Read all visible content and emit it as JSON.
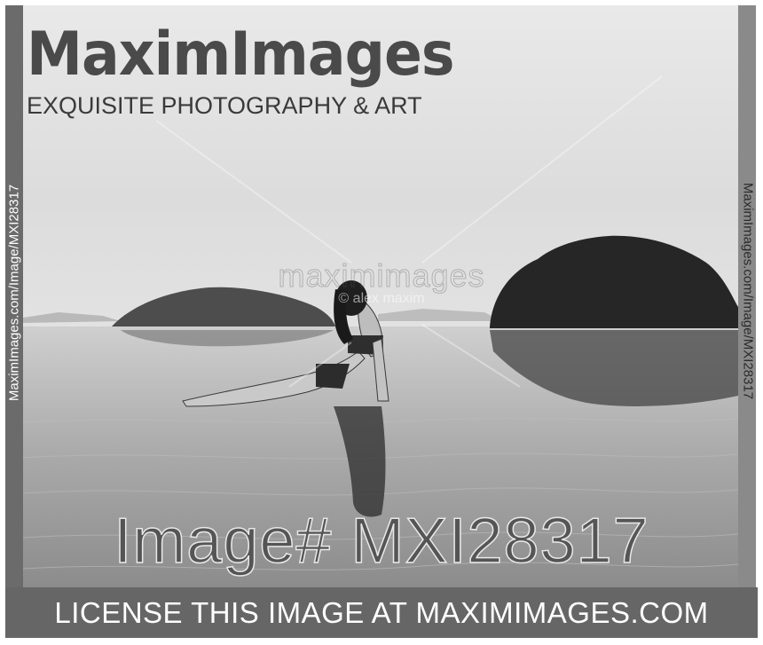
{
  "brand": {
    "title": "MaximImages",
    "subtitle": "EXQUISITE PHOTOGRAPHY & ART"
  },
  "watermarks": {
    "left_vertical": "MaximImages.com/Image/MXI28317",
    "right_vertical": "MaximImages.com/Image/MXI28317",
    "center_line1": "maximimages",
    "center_line2": "© alex maxim"
  },
  "image_id": "Image# MXI28317",
  "license": {
    "label": "LICENSE THIS IMAGE AT MAXIMIMAGES.COM"
  }
}
